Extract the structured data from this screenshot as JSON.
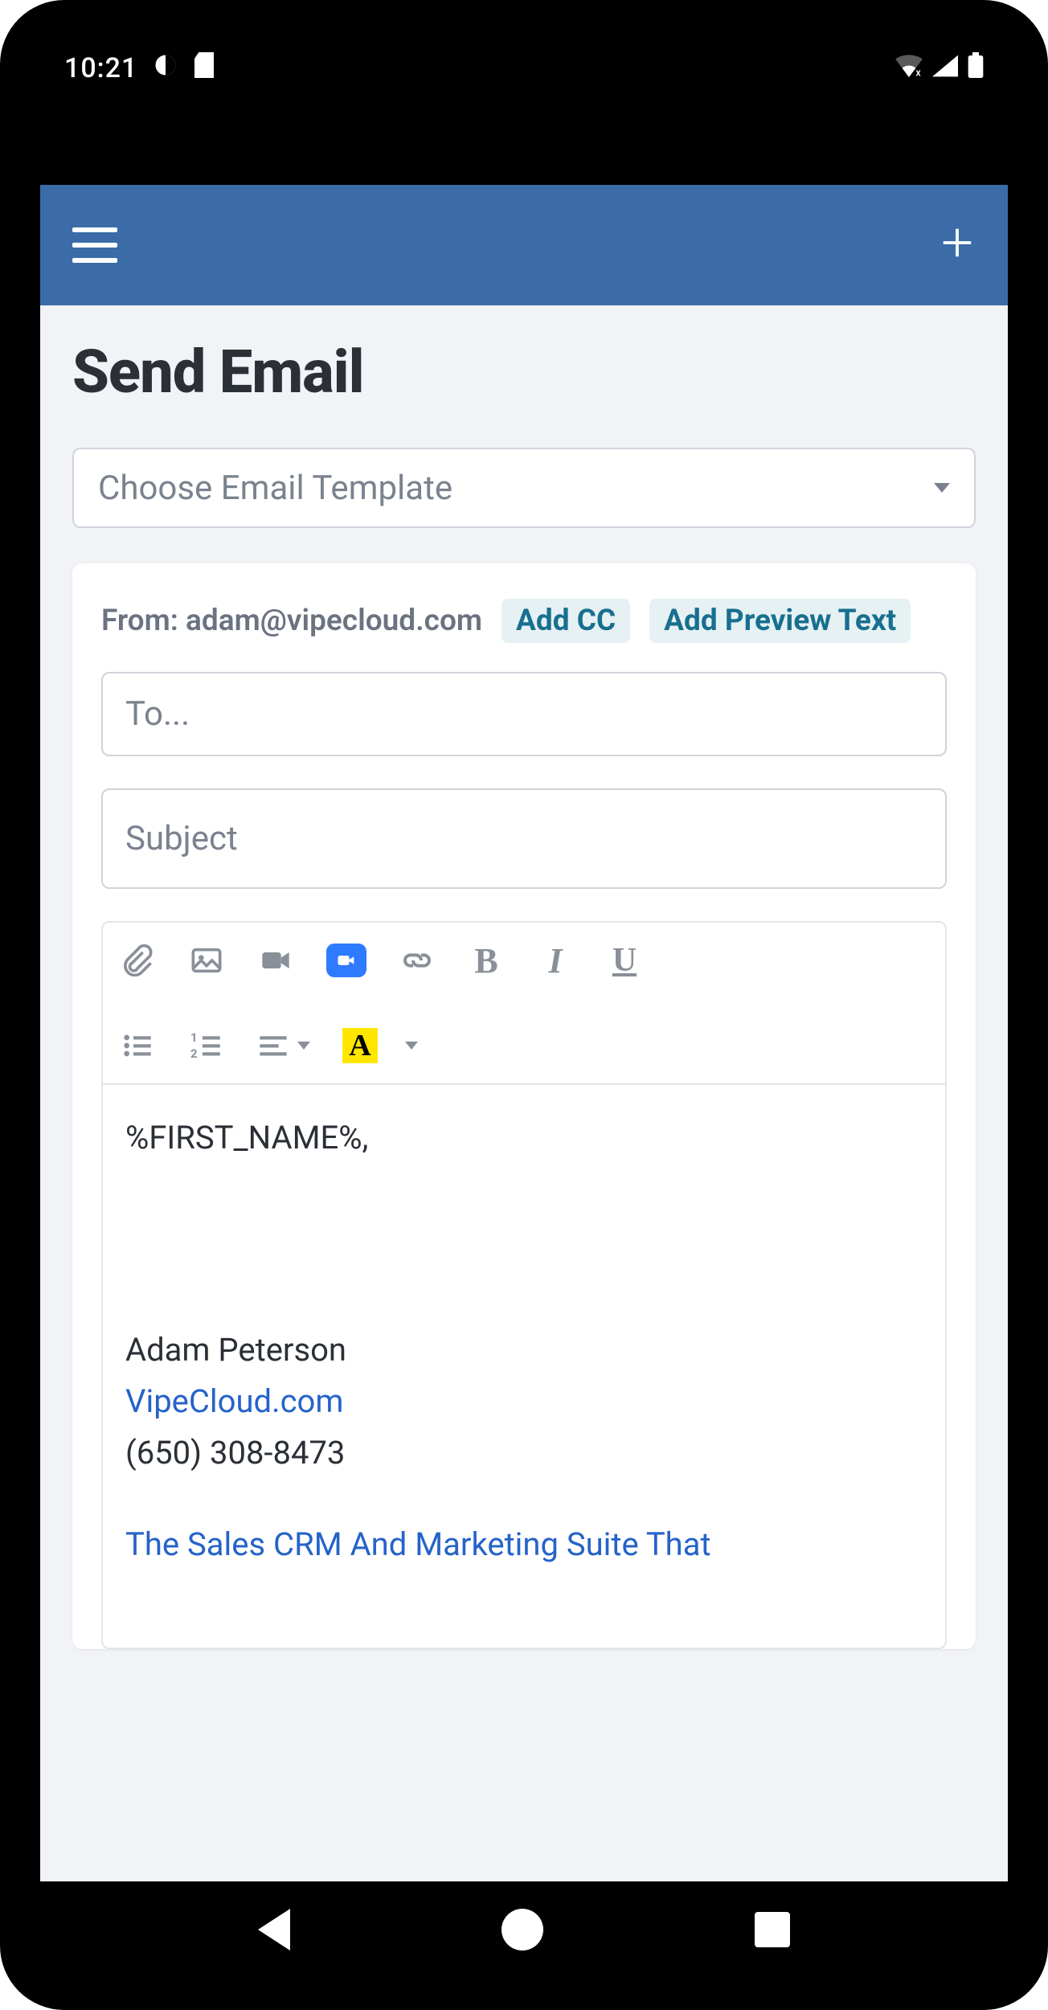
{
  "status": {
    "time": "10:21"
  },
  "page": {
    "title": "Send Email"
  },
  "template": {
    "placeholder": "Choose Email Template"
  },
  "compose": {
    "from_prefix": "From: ",
    "from_email": "adam@vipecloud.com",
    "add_cc": "Add CC",
    "add_preview": "Add Preview Text",
    "to_placeholder": "To...",
    "subject_placeholder": "Subject"
  },
  "editor": {
    "body_greeting": "%FIRST_NAME%,",
    "sig_name": "Adam Peterson",
    "sig_link": "VipeCloud.com",
    "sig_phone": "(650) 308-8473",
    "sig_tagline": "The Sales CRM And Marketing Suite That"
  },
  "toolbar": {
    "bold": "B",
    "italic": "I",
    "underline": "U",
    "font_color_letter": "A"
  }
}
